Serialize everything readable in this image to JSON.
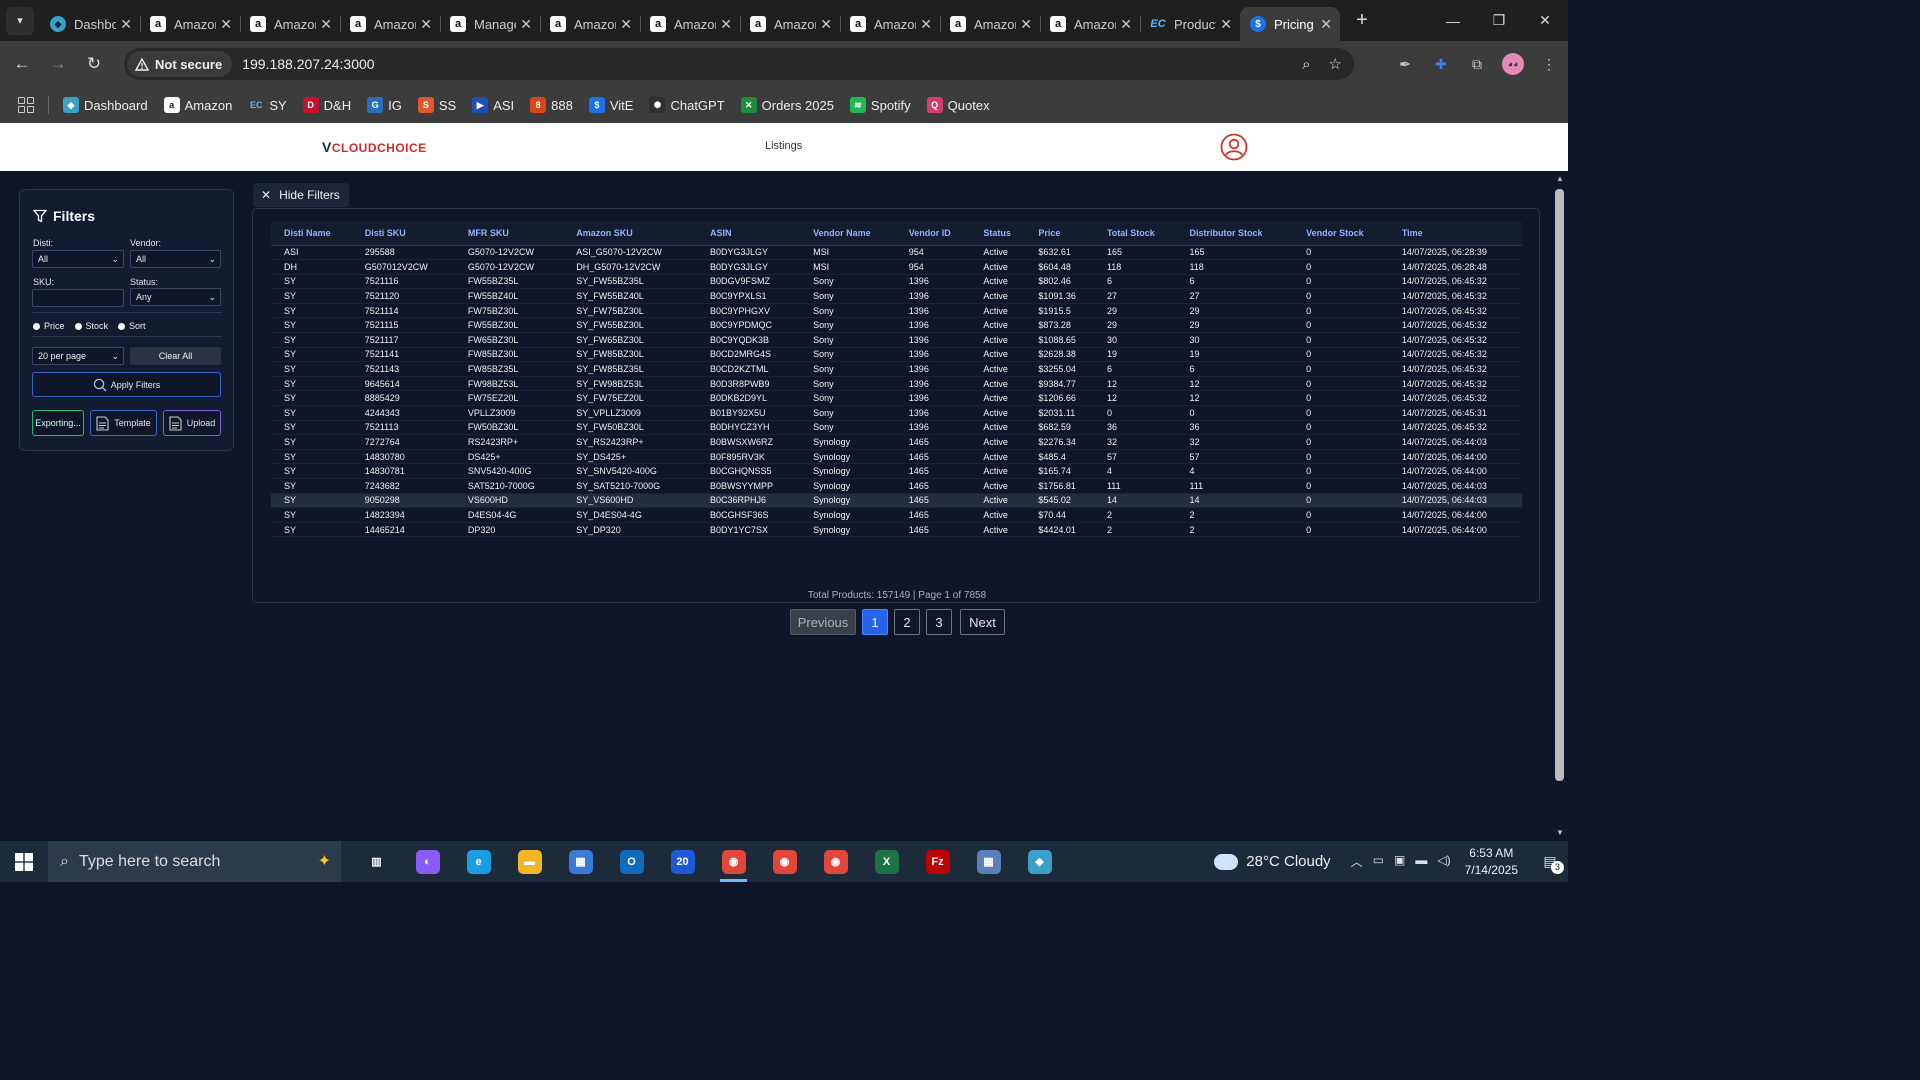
{
  "browser": {
    "tabs": [
      {
        "title": "Dashboard",
        "icon": "dashboard-icon",
        "favicon": "fav-dash",
        "glyph": "◆"
      },
      {
        "title": "Amazon",
        "icon": "amazon-icon",
        "favicon": "fav-amazon",
        "glyph": "a"
      },
      {
        "title": "Amazon",
        "icon": "amazon-icon",
        "favicon": "fav-amazon",
        "glyph": "a"
      },
      {
        "title": "Amazon",
        "icon": "amazon-icon",
        "favicon": "fav-amazon",
        "glyph": "a"
      },
      {
        "title": "Manage",
        "icon": "amazon-icon",
        "favicon": "fav-amazon",
        "glyph": "a"
      },
      {
        "title": "Amazon",
        "icon": "amazon-icon",
        "favicon": "fav-amazon",
        "glyph": "a"
      },
      {
        "title": "Amazon",
        "icon": "amazon-icon",
        "favicon": "fav-amazon",
        "glyph": "a"
      },
      {
        "title": "Amazon",
        "icon": "amazon-icon",
        "favicon": "fav-amazon",
        "glyph": "a"
      },
      {
        "title": "Amazon",
        "icon": "amazon-icon",
        "favicon": "fav-amazon",
        "glyph": "a"
      },
      {
        "title": "Amazon",
        "icon": "amazon-icon",
        "favicon": "fav-amazon",
        "glyph": "a"
      },
      {
        "title": "Amazon",
        "icon": "amazon-icon",
        "favicon": "fav-amazon",
        "glyph": "a"
      },
      {
        "title": "Products",
        "icon": "ec-icon",
        "favicon": "fav-ec",
        "glyph": "EC"
      },
      {
        "title": "Pricing",
        "icon": "dollar-icon",
        "favicon": "fav-dollar",
        "glyph": "$",
        "active": true
      }
    ],
    "security_label": "Not secure",
    "url": "199.188.207.24:3000",
    "bookmarks": [
      {
        "label": "Dashboard",
        "icon": "dashboard-icon",
        "color": "#3aa0c8",
        "glyph": "◆"
      },
      {
        "label": "Amazon",
        "icon": "amazon-icon",
        "color": "#ffffff",
        "glyph": "a"
      },
      {
        "label": "SY",
        "icon": "ec-icon",
        "color": "transparent",
        "glyph": "EC"
      },
      {
        "label": "D&H",
        "icon": "dh-icon",
        "color": "#c8102e",
        "glyph": "D"
      },
      {
        "label": "IG",
        "icon": "ig-icon",
        "color": "#2a6ebb",
        "glyph": "G"
      },
      {
        "label": "SS",
        "icon": "ss-icon",
        "color": "#e0582a",
        "glyph": "S"
      },
      {
        "label": "ASI",
        "icon": "asi-icon",
        "color": "#1f4fb5",
        "glyph": "▶"
      },
      {
        "label": "888",
        "icon": "888-icon",
        "color": "#d9461a",
        "glyph": "8"
      },
      {
        "label": "VitE",
        "icon": "dollar-icon",
        "color": "#1a73e8",
        "glyph": "$"
      },
      {
        "label": "ChatGPT",
        "icon": "chatgpt-icon",
        "color": "#2f2f2f",
        "glyph": "✺"
      },
      {
        "label": "Orders 2025",
        "icon": "sheets-icon",
        "color": "#1e8e3e",
        "glyph": "✕"
      },
      {
        "label": "Spotify",
        "icon": "spotify-icon",
        "color": "#1db954",
        "glyph": "≋"
      },
      {
        "label": "Quotex",
        "icon": "quotex-icon",
        "color": "#d23e72",
        "glyph": "Q"
      }
    ]
  },
  "app": {
    "logo_v": "V",
    "logo_text": "CLOUDCHOICE",
    "nav_listings": "Listings",
    "filters": {
      "title": "Filters",
      "disti_label": "Disti:",
      "disti_value": "All",
      "vendor_label": "Vendor:",
      "vendor_value": "All",
      "sku_label": "SKU:",
      "sku_value": "",
      "status_label": "Status:",
      "status_value": "Any",
      "radio_price": "Price",
      "radio_stock": "Stock",
      "radio_sort": "Sort",
      "per_page": "20 per page",
      "clear_all": "Clear All",
      "apply": "Apply Filters",
      "exporting": "Exporting...",
      "template": "Template",
      "upload": "Upload"
    },
    "hide_filters": "Hide Filters",
    "table": {
      "columns": [
        "Disti Name",
        "Disti SKU",
        "MFR SKU",
        "Amazon SKU",
        "ASIN",
        "Vendor Name",
        "Vendor ID",
        "Status",
        "Price",
        "Total Stock",
        "Distributor Stock",
        "Vendor Stock",
        "Time"
      ],
      "rows": [
        [
          "ASI",
          "295588",
          "G5070-12V2CW",
          "ASI_G5070-12V2CW",
          "B0DYG3JLGY",
          "MSI",
          "954",
          "Active",
          "$632.61",
          "165",
          "165",
          "0",
          "14/07/2025, 06:28:39"
        ],
        [
          "DH",
          "G507012V2CW",
          "G5070-12V2CW",
          "DH_G5070-12V2CW",
          "B0DYG3JLGY",
          "MSI",
          "954",
          "Active",
          "$604.48",
          "118",
          "118",
          "0",
          "14/07/2025, 06:28:48"
        ],
        [
          "SY",
          "7521116",
          "FW55BZ35L",
          "SY_FW55BZ35L",
          "B0DGV9FSMZ",
          "Sony",
          "1396",
          "Active",
          "$802.46",
          "6",
          "6",
          "0",
          "14/07/2025, 06:45:32"
        ],
        [
          "SY",
          "7521120",
          "FW55BZ40L",
          "SY_FW55BZ40L",
          "B0C9YPXLS1",
          "Sony",
          "1396",
          "Active",
          "$1091.36",
          "27",
          "27",
          "0",
          "14/07/2025, 06:45:32"
        ],
        [
          "SY",
          "7521114",
          "FW75BZ30L",
          "SY_FW75BZ30L",
          "B0C9YPHGXV",
          "Sony",
          "1396",
          "Active",
          "$1915.5",
          "29",
          "29",
          "0",
          "14/07/2025, 06:45:32"
        ],
        [
          "SY",
          "7521115",
          "FW55BZ30L",
          "SY_FW55BZ30L",
          "B0C9YPDMQC",
          "Sony",
          "1396",
          "Active",
          "$873.28",
          "29",
          "29",
          "0",
          "14/07/2025, 06:45:32"
        ],
        [
          "SY",
          "7521117",
          "FW65BZ30L",
          "SY_FW65BZ30L",
          "B0C9YQDK3B",
          "Sony",
          "1396",
          "Active",
          "$1088.65",
          "30",
          "30",
          "0",
          "14/07/2025, 06:45:32"
        ],
        [
          "SY",
          "7521141",
          "FW85BZ30L",
          "SY_FW85BZ30L",
          "B0CD2MRG4S",
          "Sony",
          "1396",
          "Active",
          "$2628.38",
          "19",
          "19",
          "0",
          "14/07/2025, 06:45:32"
        ],
        [
          "SY",
          "7521143",
          "FW85BZ35L",
          "SY_FW85BZ35L",
          "B0CD2KZTML",
          "Sony",
          "1396",
          "Active",
          "$3255.04",
          "6",
          "6",
          "0",
          "14/07/2025, 06:45:32"
        ],
        [
          "SY",
          "9645614",
          "FW98BZ53L",
          "SY_FW98BZ53L",
          "B0D3R8PWB9",
          "Sony",
          "1396",
          "Active",
          "$9384.77",
          "12",
          "12",
          "0",
          "14/07/2025, 06:45:32"
        ],
        [
          "SY",
          "8885429",
          "FW75EZ20L",
          "SY_FW75EZ20L",
          "B0DKB2D9YL",
          "Sony",
          "1396",
          "Active",
          "$1206.66",
          "12",
          "12",
          "0",
          "14/07/2025, 06:45:32"
        ],
        [
          "SY",
          "4244343",
          "VPLLZ3009",
          "SY_VPLLZ3009",
          "B01BY92X5U",
          "Sony",
          "1396",
          "Active",
          "$2031.11",
          "0",
          "0",
          "0",
          "14/07/2025, 06:45:31"
        ],
        [
          "SY",
          "7521113",
          "FW50BZ30L",
          "SY_FW50BZ30L",
          "B0DHYCZ3YH",
          "Sony",
          "1396",
          "Active",
          "$682.59",
          "36",
          "36",
          "0",
          "14/07/2025, 06:45:32"
        ],
        [
          "SY",
          "7272764",
          "RS2423RP+",
          "SY_RS2423RP+",
          "B0BWSXW6RZ",
          "Synology",
          "1465",
          "Active",
          "$2276.34",
          "32",
          "32",
          "0",
          "14/07/2025, 06:44:03"
        ],
        [
          "SY",
          "14830780",
          "DS425+",
          "SY_DS425+",
          "B0F895RV3K",
          "Synology",
          "1465",
          "Active",
          "$485.4",
          "57",
          "57",
          "0",
          "14/07/2025, 06:44:00"
        ],
        [
          "SY",
          "14830781",
          "SNV5420-400G",
          "SY_SNV5420-400G",
          "B0CGHQNSS5",
          "Synology",
          "1465",
          "Active",
          "$165.74",
          "4",
          "4",
          "0",
          "14/07/2025, 06:44:00"
        ],
        [
          "SY",
          "7243682",
          "SAT5210-7000G",
          "SY_SAT5210-7000G",
          "B0BWSYYMPP",
          "Synology",
          "1465",
          "Active",
          "$1756.81",
          "111",
          "111",
          "0",
          "14/07/2025, 06:44:03"
        ],
        [
          "SY",
          "9050298",
          "VS600HD",
          "SY_VS600HD",
          "B0C36RPHJ6",
          "Synology",
          "1465",
          "Active",
          "$545.02",
          "14",
          "14",
          "0",
          "14/07/2025, 06:44:03"
        ],
        [
          "SY",
          "14823394",
          "D4ES04-4G",
          "SY_D4ES04-4G",
          "B0CGHSF36S",
          "Synology",
          "1465",
          "Active",
          "$70.44",
          "2",
          "2",
          "0",
          "14/07/2025, 06:44:00"
        ],
        [
          "SY",
          "14465214",
          "DP320",
          "SY_DP320",
          "B0DY1YC7SX",
          "Synology",
          "1465",
          "Active",
          "$4424.01",
          "2",
          "2",
          "0",
          "14/07/2025, 06:44:00"
        ]
      ],
      "highlight_row": 17
    },
    "totals": "Total Products: 157149 | Page 1 of 7858",
    "pagination": {
      "previous": "Previous",
      "pages": [
        "1",
        "2",
        "3"
      ],
      "next": "Next",
      "current": "1"
    }
  },
  "taskbar": {
    "search_placeholder": "Type here to search",
    "apps": [
      {
        "icon": "task-view-icon",
        "color": "transparent",
        "glyph": "▥"
      },
      {
        "icon": "copilot-icon",
        "color": "#8a5cf6",
        "glyph": "◐"
      },
      {
        "icon": "edge-icon",
        "color": "#1b9de2",
        "glyph": "e"
      },
      {
        "icon": "file-explorer-icon",
        "color": "#f2b824",
        "glyph": "▬"
      },
      {
        "icon": "store-icon",
        "color": "#3a7bd5",
        "glyph": "▦"
      },
      {
        "icon": "outlook-icon",
        "color": "#0f6cbd",
        "glyph": "O"
      },
      {
        "icon": "calendar-icon",
        "color": "#1e5ad6",
        "glyph": "20"
      },
      {
        "icon": "chrome-icon",
        "color": "#e0463a",
        "glyph": "◉",
        "active": true
      },
      {
        "icon": "chrome-icon",
        "color": "#e0463a",
        "glyph": "◉"
      },
      {
        "icon": "chrome-icon",
        "color": "#e0463a",
        "glyph": "◉"
      },
      {
        "icon": "excel-icon",
        "color": "#1e7145",
        "glyph": "X"
      },
      {
        "icon": "filezilla-icon",
        "color": "#bf0000",
        "glyph": "Fz"
      },
      {
        "icon": "calculator-icon",
        "color": "#5b7fb8",
        "glyph": "▦"
      },
      {
        "icon": "dashboard-app-icon",
        "color": "#3aa0c8",
        "glyph": "◆"
      }
    ],
    "weather": "28°C  Cloudy",
    "time": "6:53 AM",
    "date": "7/14/2025",
    "notifications": "3"
  }
}
